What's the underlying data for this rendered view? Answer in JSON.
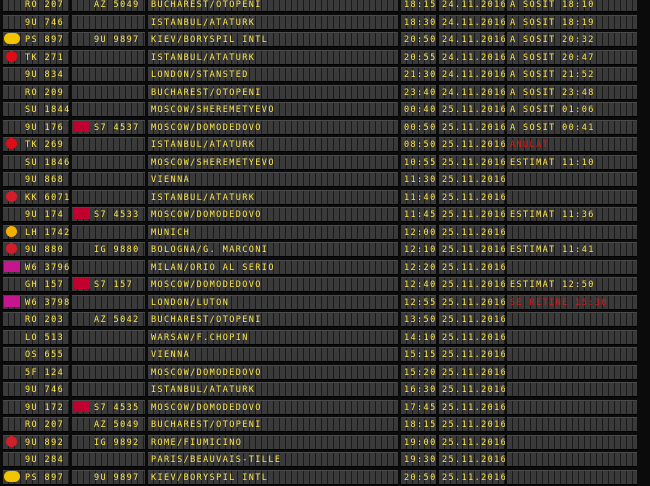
{
  "rows": [
    {
      "logo": "plane-tail-icon",
      "flight": "RO 207",
      "codeshare": "AZ 5049",
      "codeshare_logo": "triangle-icon",
      "destination": "BUCHAREST/OTOPENI",
      "time": "18:15",
      "date": "24.11.2016",
      "status": "A SOSIT 18:10",
      "status_color": "#ffe84a"
    },
    {
      "logo": "swoosh-icon",
      "flight": "9U 746",
      "codeshare": "",
      "destination": "ISTANBUL/ATATURK",
      "time": "18:30",
      "date": "24.11.2016",
      "status": "A SOSIT 18:19",
      "status_color": "#ffe84a"
    },
    {
      "logo": "smiley-icon",
      "flight": "PS 897",
      "codeshare": "9U 9897",
      "codeshare_logo": "swoosh-icon",
      "destination": "KIEV/BORYSPIL INTL",
      "time": "20:50",
      "date": "24.11.2016",
      "status": "A SOSIT 20:32",
      "status_color": "#ffe84a"
    },
    {
      "logo": "crescent-icon",
      "flight": "TK 271",
      "codeshare": "",
      "destination": "ISTANBUL/ATATURK",
      "time": "20:55",
      "date": "24.11.2016",
      "status": "A SOSIT 20:47",
      "status_color": "#ffe84a"
    },
    {
      "logo": "swoosh-icon",
      "flight": "9U 834",
      "codeshare": "",
      "destination": "LONDON/STANSTED",
      "time": "21:30",
      "date": "24.11.2016",
      "status": "A SOSIT 21:52",
      "status_color": "#ffe84a"
    },
    {
      "logo": "plane-tail-icon",
      "flight": "RO 209",
      "codeshare": "",
      "destination": "BUCHAREST/OTOPENI",
      "time": "23:40",
      "date": "24.11.2016",
      "status": "A SOSIT 23:48",
      "status_color": "#ffe84a"
    },
    {
      "logo": "wings-icon",
      "flight": "SU 1844",
      "codeshare": "",
      "destination": "MOSCOW/SHEREMETYEVO",
      "time": "00:40",
      "date": "25.11.2016",
      "status": "A SOSIT 01:06",
      "status_color": "#ffe84a"
    },
    {
      "logo": "swoosh-icon",
      "flight": "9U 176",
      "codeshare": "S7 4537",
      "codeshare_logo": "s7-icon",
      "destination": "MOSCOW/DOMODEDOVO",
      "time": "00:50",
      "date": "25.11.2016",
      "status": "A SOSIT 00:41",
      "status_color": "#ffe84a"
    },
    {
      "logo": "crescent-icon",
      "flight": "TK 269",
      "codeshare": "",
      "destination": "ISTANBUL/ATATURK",
      "time": "08:50",
      "date": "25.11.2016",
      "status": "ANULAT",
      "status_color": "#e01818"
    },
    {
      "logo": "wings-icon",
      "flight": "SU 1846",
      "codeshare": "",
      "destination": "MOSCOW/SHEREMETYEVO",
      "time": "10:55",
      "date": "25.11.2016",
      "status": "ESTIMAT 11:10",
      "status_color": "#ffe84a"
    },
    {
      "logo": "swoosh-icon",
      "flight": "9U 868",
      "codeshare": "",
      "destination": "VIENNA",
      "time": "11:30",
      "date": "25.11.2016",
      "status": "",
      "status_color": "#ffe84a"
    },
    {
      "logo": "circle-red-icon",
      "flight": "KK 6071",
      "codeshare": "",
      "destination": "ISTANBUL/ATATURK",
      "time": "11:40",
      "date": "25.11.2016",
      "status": "",
      "status_color": "#ffe84a"
    },
    {
      "logo": "swoosh-icon",
      "flight": "9U 174",
      "codeshare": "S7 4533",
      "codeshare_logo": "s7-icon",
      "destination": "MOSCOW/DOMODEDOVO",
      "time": "11:45",
      "date": "25.11.2016",
      "status": "ESTIMAT 11:36",
      "status_color": "#ffe84a"
    },
    {
      "logo": "crane-icon",
      "flight": "LH 1742",
      "codeshare": "",
      "destination": "MUNICH",
      "time": "12:00",
      "date": "25.11.2016",
      "status": "",
      "status_color": "#ffe84a"
    },
    {
      "logo": "swoosh-icon",
      "flight": "9U 880",
      "codeshare": "IG 9880",
      "codeshare_logo": "circle-red-icon",
      "destination": "BOLOGNA/G. MARCONI",
      "time": "12:10",
      "date": "25.11.2016",
      "status": "ESTIMAT 11:41",
      "status_color": "#ffe84a"
    },
    {
      "logo": "wizz-icon",
      "flight": "W6 3796",
      "codeshare": "",
      "destination": "MILAN/ORIO AL SERIO",
      "time": "12:20",
      "date": "25.11.2016",
      "status": "",
      "status_color": "#ffe84a"
    },
    {
      "logo": "diamond-icon",
      "flight": "GH 157",
      "codeshare": "S7 157",
      "codeshare_logo": "s7-icon",
      "destination": "MOSCOW/DOMODEDOVO",
      "time": "12:40",
      "date": "25.11.2016",
      "status": "ESTIMAT 12:50",
      "status_color": "#ffe84a"
    },
    {
      "logo": "wizz-icon",
      "flight": "W6 3798",
      "codeshare": "",
      "destination": "LONDON/LUTON",
      "time": "12:55",
      "date": "25.11.2016",
      "status": "SE RETINE 15:30",
      "status_color": "#e01818"
    },
    {
      "logo": "plane-tail-icon",
      "flight": "RO 203",
      "codeshare": "AZ 5042",
      "codeshare_logo": "triangle-icon",
      "destination": "BUCHAREST/OTOPENI",
      "time": "13:50",
      "date": "25.11.2016",
      "status": "",
      "status_color": "#ffe84a"
    },
    {
      "logo": "crane-blue-icon",
      "flight": "LO 513",
      "codeshare": "",
      "destination": "WARSAW/F.CHOPIN",
      "time": "14:10",
      "date": "25.11.2016",
      "status": "",
      "status_color": "#ffe84a"
    },
    {
      "logo": "stripe-red-icon",
      "flight": "OS 655",
      "codeshare": "",
      "destination": "VIENNA",
      "time": "15:15",
      "date": "25.11.2016",
      "status": "",
      "status_color": "#ffe84a"
    },
    {
      "logo": "stripe-blue-icon",
      "flight": "5F 124",
      "codeshare": "",
      "destination": "MOSCOW/DOMODEDOVO",
      "time": "15:20",
      "date": "25.11.2016",
      "status": "",
      "status_color": "#ffe84a"
    },
    {
      "logo": "swoosh-icon",
      "flight": "9U 746",
      "codeshare": "",
      "destination": "ISTANBUL/ATATURK",
      "time": "16:30",
      "date": "25.11.2016",
      "status": "",
      "status_color": "#ffe84a"
    },
    {
      "logo": "swoosh-icon",
      "flight": "9U 172",
      "codeshare": "S7 4535",
      "codeshare_logo": "s7-icon",
      "destination": "MOSCOW/DOMODEDOVO",
      "time": "17:45",
      "date": "25.11.2016",
      "status": "",
      "status_color": "#ffe84a"
    },
    {
      "logo": "plane-tail-icon",
      "flight": "RO 207",
      "codeshare": "AZ 5049",
      "codeshare_logo": "triangle-icon",
      "destination": "BUCHAREST/OTOPENI",
      "time": "18:15",
      "date": "25.11.2016",
      "status": "",
      "status_color": "#ffe84a"
    },
    {
      "logo": "swoosh-icon",
      "flight": "9U 892",
      "codeshare": "IG 9892",
      "codeshare_logo": "circle-red-icon",
      "destination": "ROME/FIUMICINO",
      "time": "19:00",
      "date": "25.11.2016",
      "status": "",
      "status_color": "#ffe84a"
    },
    {
      "logo": "swoosh-icon",
      "flight": "9U 284",
      "codeshare": "",
      "destination": "PARIS/BEAUVAIS-TILLE",
      "time": "19:30",
      "date": "25.11.2016",
      "status": "",
      "status_color": "#ffe84a"
    },
    {
      "logo": "smiley-icon",
      "flight": "PS 897",
      "codeshare": "9U 9897",
      "codeshare_logo": "swoosh-icon",
      "destination": "KIEV/BORYSPIL INTL",
      "time": "20:50",
      "date": "25.11.2016",
      "status": "",
      "status_color": "#ffe84a"
    }
  ]
}
